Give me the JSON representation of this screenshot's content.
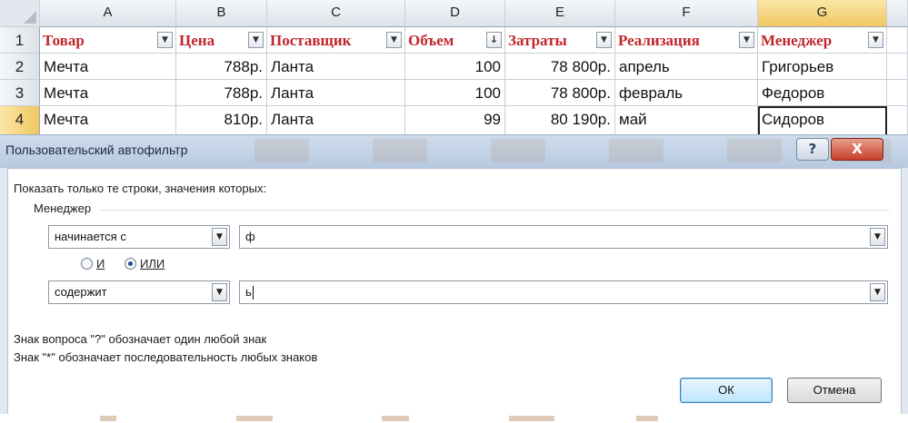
{
  "sheet": {
    "columns": [
      "A",
      "B",
      "C",
      "D",
      "E",
      "F",
      "G"
    ],
    "rows": [
      "1",
      "2",
      "3",
      "4"
    ],
    "headers": [
      "Товар",
      "Цена",
      "Поставщик",
      "Объем",
      "Затраты",
      "Реализация",
      "Менеджер"
    ],
    "filter_glyph": "▼",
    "sorted_glyph": "↓",
    "data": [
      [
        "Мечта",
        "788р.",
        "Ланта",
        "100",
        "78 800р.",
        "апрель",
        "Григорьев"
      ],
      [
        "Мечта",
        "788р.",
        "Ланта",
        "100",
        "78 800р.",
        "февраль",
        "Федоров"
      ],
      [
        "Мечта",
        "810р.",
        "Ланта",
        "99",
        "80 190р.",
        "май",
        "Сидоров"
      ]
    ],
    "header_color": "#c0262b",
    "selected_header_color": "#f1c761"
  },
  "dialog": {
    "title": "Пользовательский автофильтр",
    "help_label": "?",
    "close_label": "X",
    "instruction": "Показать только те строки, значения которых:",
    "field_name": "Менеджер",
    "condition1": {
      "operator": "начинается с",
      "value": "ф"
    },
    "logic": {
      "and_label": "И",
      "or_label": "ИЛИ",
      "selected": "ИЛИ"
    },
    "condition2": {
      "operator": "содержит",
      "value": "ь"
    },
    "hint1": "Знак вопроса \"?\" обозначает один любой знак",
    "hint2": "Знак \"*\" обозначает последовательность любых знаков",
    "ok_label": "ОК",
    "cancel_label": "Отмена"
  }
}
